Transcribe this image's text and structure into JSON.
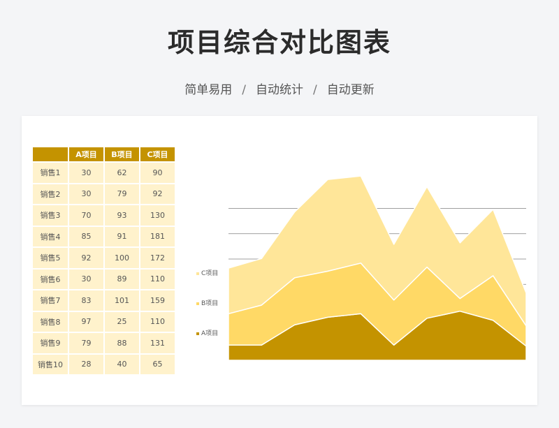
{
  "header": {
    "title": "项目综合对比图表",
    "tagline_parts": [
      "简单易用",
      "自动统计",
      "自动更新"
    ],
    "tagline_separator": "/"
  },
  "table": {
    "corner": "",
    "columns": [
      "A项目",
      "B项目",
      "C项目"
    ]
  },
  "colors": {
    "A": "#c49300",
    "B": "#ffd966",
    "C": "#ffe699",
    "header_bg": "#c49300",
    "cell_bg": "#fff2cc",
    "grid": "#7f7f7f"
  },
  "chart_data": {
    "type": "area",
    "stacked": true,
    "categories": [
      "销售1",
      "销售2",
      "销售3",
      "销售4",
      "销售5",
      "销售6",
      "销售7",
      "销售8",
      "销售9",
      "销售10"
    ],
    "series": [
      {
        "name": "A项目",
        "values": [
          30,
          30,
          70,
          85,
          92,
          30,
          83,
          97,
          79,
          28
        ]
      },
      {
        "name": "B项目",
        "values": [
          62,
          79,
          93,
          91,
          100,
          89,
          101,
          25,
          88,
          40
        ]
      },
      {
        "name": "C项目",
        "values": [
          90,
          92,
          130,
          181,
          172,
          110,
          159,
          110,
          131,
          65
        ]
      }
    ],
    "ylim": [
      0,
      400
    ],
    "grid": true,
    "legend_position": "left"
  }
}
